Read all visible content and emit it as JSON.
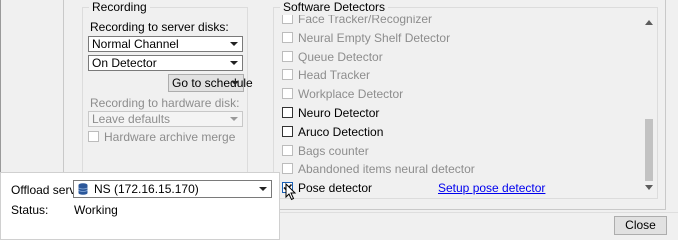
{
  "recording": {
    "title": "Recording",
    "server_disks_label": "Recording to server disks:",
    "channel_value": "Normal Channel",
    "trigger_value": "On Detector",
    "schedule_button": "Go to schedule",
    "hardware_disk_label": "Recording to hardware disk:",
    "hardware_value": "Leave defaults",
    "hardware_merge_label": "Hardware archive merge"
  },
  "detectors": {
    "title": "Software Detectors",
    "items": [
      {
        "label": "Face Tracker/Recognizer",
        "checked": false,
        "enabled": false
      },
      {
        "label": "Neural Empty Shelf Detector",
        "checked": false,
        "enabled": false
      },
      {
        "label": "Queue Detector",
        "checked": false,
        "enabled": false
      },
      {
        "label": "Head Tracker",
        "checked": false,
        "enabled": false
      },
      {
        "label": "Workplace Detector",
        "checked": false,
        "enabled": false
      },
      {
        "label": "Neuro Detector",
        "checked": false,
        "enabled": true
      },
      {
        "label": "Aruco Detection",
        "checked": false,
        "enabled": true
      },
      {
        "label": "Bags counter",
        "checked": false,
        "enabled": false
      },
      {
        "label": "Abandoned items neural detector",
        "checked": false,
        "enabled": false
      },
      {
        "label": "Pose detector",
        "checked": true,
        "enabled": true
      }
    ],
    "setup_link": "Setup pose detector"
  },
  "offload": {
    "server_label": "Offload server:",
    "server_value": "NS (172.16.15.170)",
    "status_label": "Status:",
    "status_value": "Working"
  },
  "footer": {
    "close_label": "Close"
  },
  "icons": {
    "server": "database-icon",
    "dropdown": "chevron-down-icon"
  },
  "colors": {
    "link": "#0000ee",
    "disabled_text": "#8d8d8d",
    "server_icon": "#2b579a"
  }
}
